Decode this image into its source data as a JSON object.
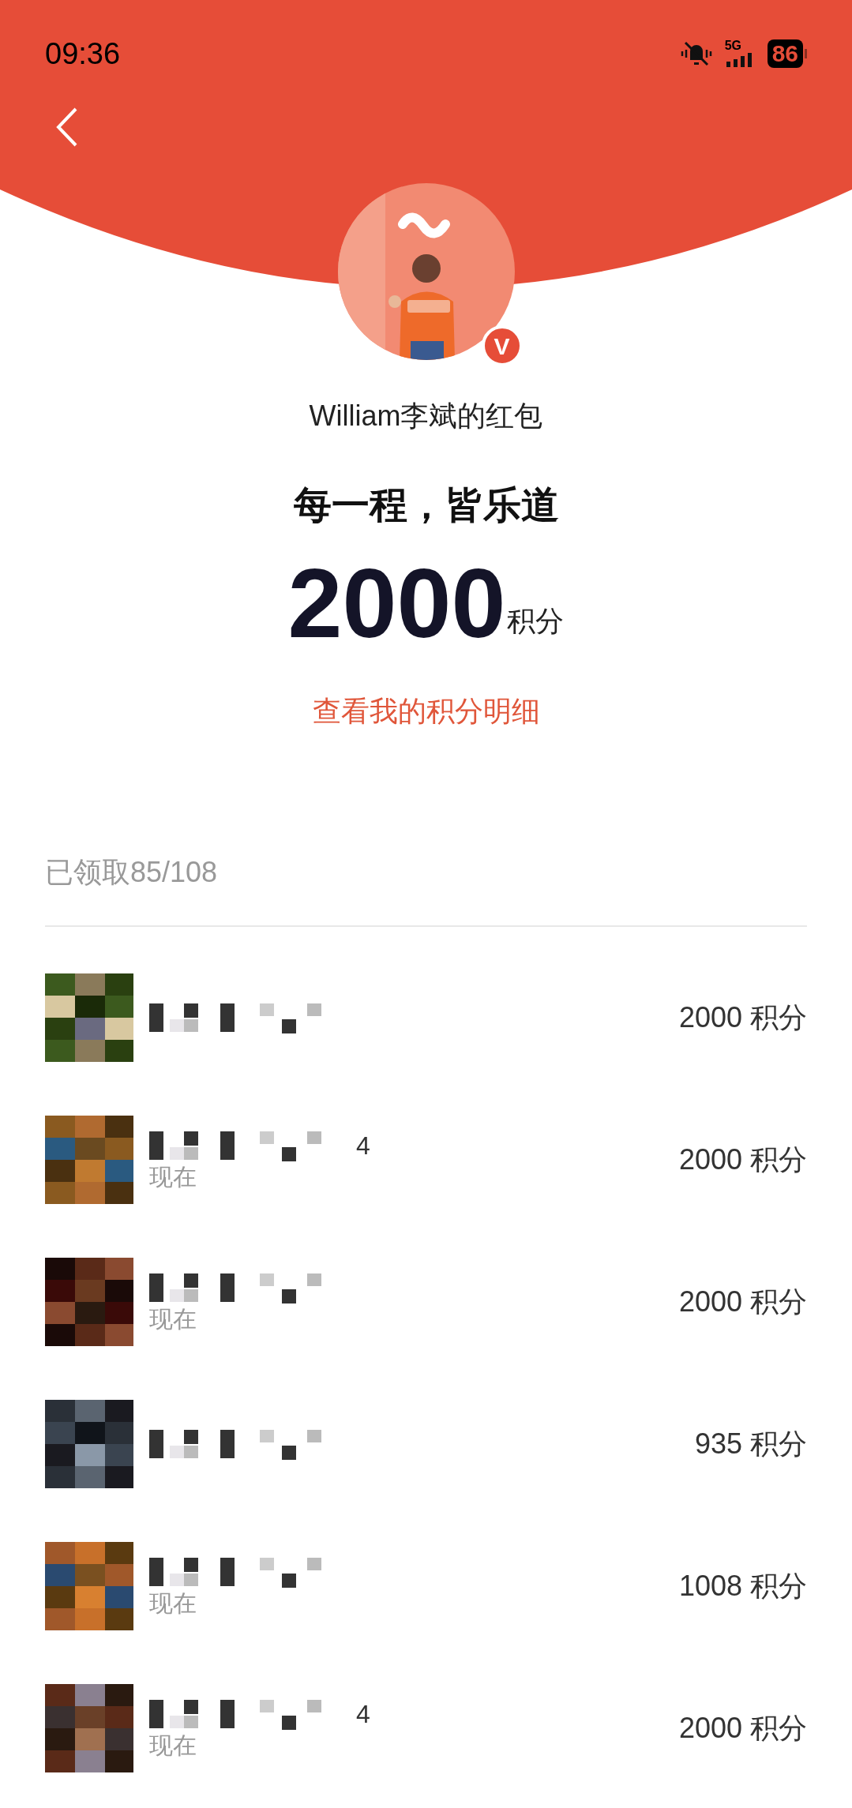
{
  "status_bar": {
    "time": "09:36",
    "network": "5G",
    "battery": "86"
  },
  "sender": {
    "verified_badge": "V",
    "name": "William李斌的红包"
  },
  "greeting": "每一程，皆乐道",
  "amount": {
    "value": "2000",
    "unit": "积分"
  },
  "details_link": "查看我的积分明细",
  "claimed": "已领取85/108",
  "recipients": [
    {
      "points": "2000 积分"
    },
    {
      "name_fragment": "4",
      "time": "现在",
      "points": "2000 积分"
    },
    {
      "time": "现在",
      "points": "2000 积分"
    },
    {
      "points": "935 积分"
    },
    {
      "time": "现在",
      "points": "1008 积分"
    },
    {
      "name_fragment": "4",
      "time": "现在",
      "points": "2000 积分"
    }
  ]
}
